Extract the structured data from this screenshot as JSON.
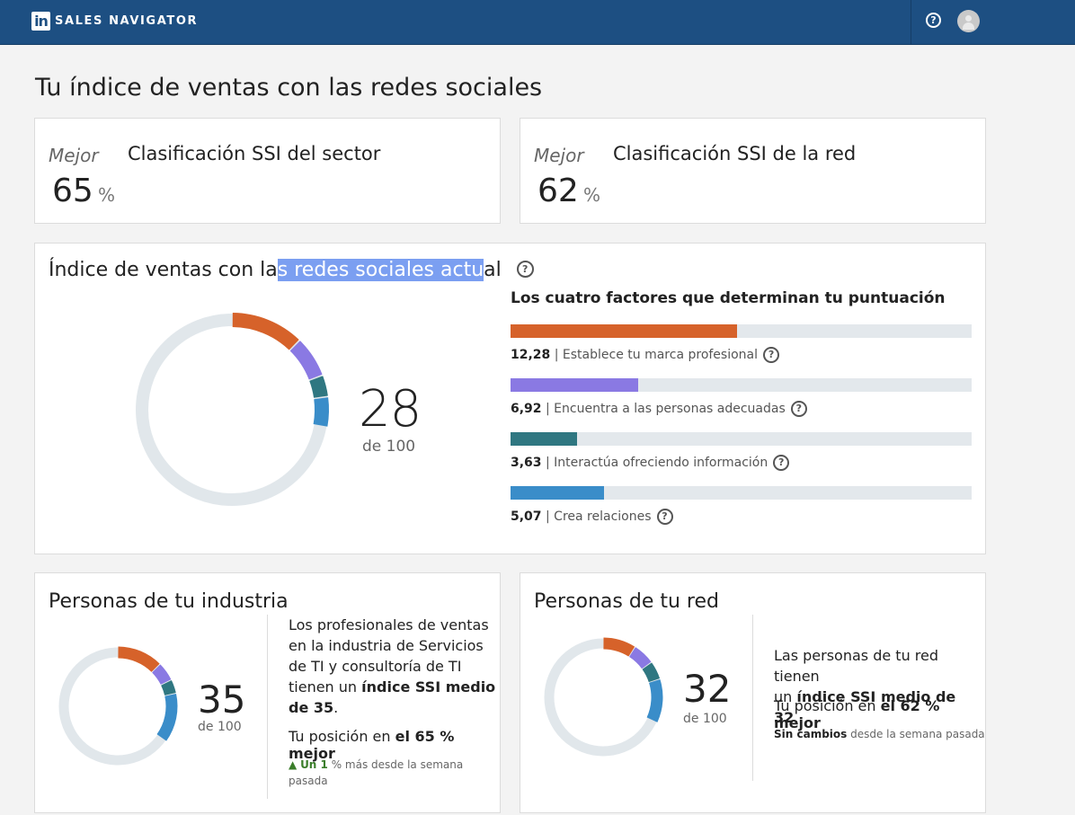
{
  "header": {
    "logo_text": "in",
    "brand": "SALES NAVIGATOR",
    "help_icon": "question-circle-icon",
    "avatar_icon": "user-avatar-icon"
  },
  "page_title": "Tu índice de ventas con las redes sociales",
  "industry_rank": {
    "prefix": "Mejor",
    "value": "65",
    "unit": "%",
    "title": "Clasificación SSI del sector"
  },
  "network_rank": {
    "prefix": "Mejor",
    "value": "62",
    "unit": "%",
    "title": "Clasificación SSI de la red"
  },
  "ssi": {
    "title_before": "Índice de ventas con la",
    "title_selected": "s redes sociales actu",
    "title_after": "al",
    "score": "28",
    "out_of": "de 100",
    "factors_title": "Los cuatro factores que determinan tu puntuación",
    "factors": [
      {
        "value": "12,28",
        "label": "| Establece tu marca profesional",
        "score": 12.28,
        "max": 25,
        "color": "#d6622a"
      },
      {
        "value": "6,92",
        "label": "| Encuentra a las personas adecuadas",
        "score": 6.92,
        "max": 25,
        "color": "#8a79e3"
      },
      {
        "value": "3,63",
        "label": "| Interactúa ofreciendo información",
        "score": 3.63,
        "max": 25,
        "color": "#2f7781"
      },
      {
        "value": "5,07",
        "label": "| Crea relaciones",
        "score": 5.07,
        "max": 25,
        "color": "#3a8dc9"
      }
    ]
  },
  "industry": {
    "title": "Personas de tu industria",
    "score": "35",
    "out_of": "de 100",
    "segments": [
      12.5,
      5.2,
      3.8,
      13.5
    ],
    "desc_lines": [
      "Los profesionales de ventas",
      "en la industria de Servicios",
      "de TI y consultoría de TI"
    ],
    "desc_line4_plain": "tienen un ",
    "desc_line4_bold": "índice SSI medio",
    "desc_line5_bold": "de 35",
    "desc_line5_end": ".",
    "position_plain": "Tu posición en ",
    "position_bold": "el 65 % mejor",
    "change_bold": "Un 1",
    "change_rest": " % más desde la semana",
    "change_line2": "pasada"
  },
  "network": {
    "title": "Personas de tu red",
    "score": "32",
    "out_of": "de 100",
    "segments": [
      9.0,
      6.0,
      5.0,
      12.0
    ],
    "desc_line1": "Las personas de tu red tienen",
    "desc_line2_plain": "un ",
    "desc_line2_bold": "índice SSI medio de 32",
    "desc_line2_end": ".",
    "position_plain": "Tu posición en ",
    "position_bold": "el 62 % mejor",
    "change_bold": "Sin cambios",
    "change_rest": " desde la semana pasada"
  }
}
